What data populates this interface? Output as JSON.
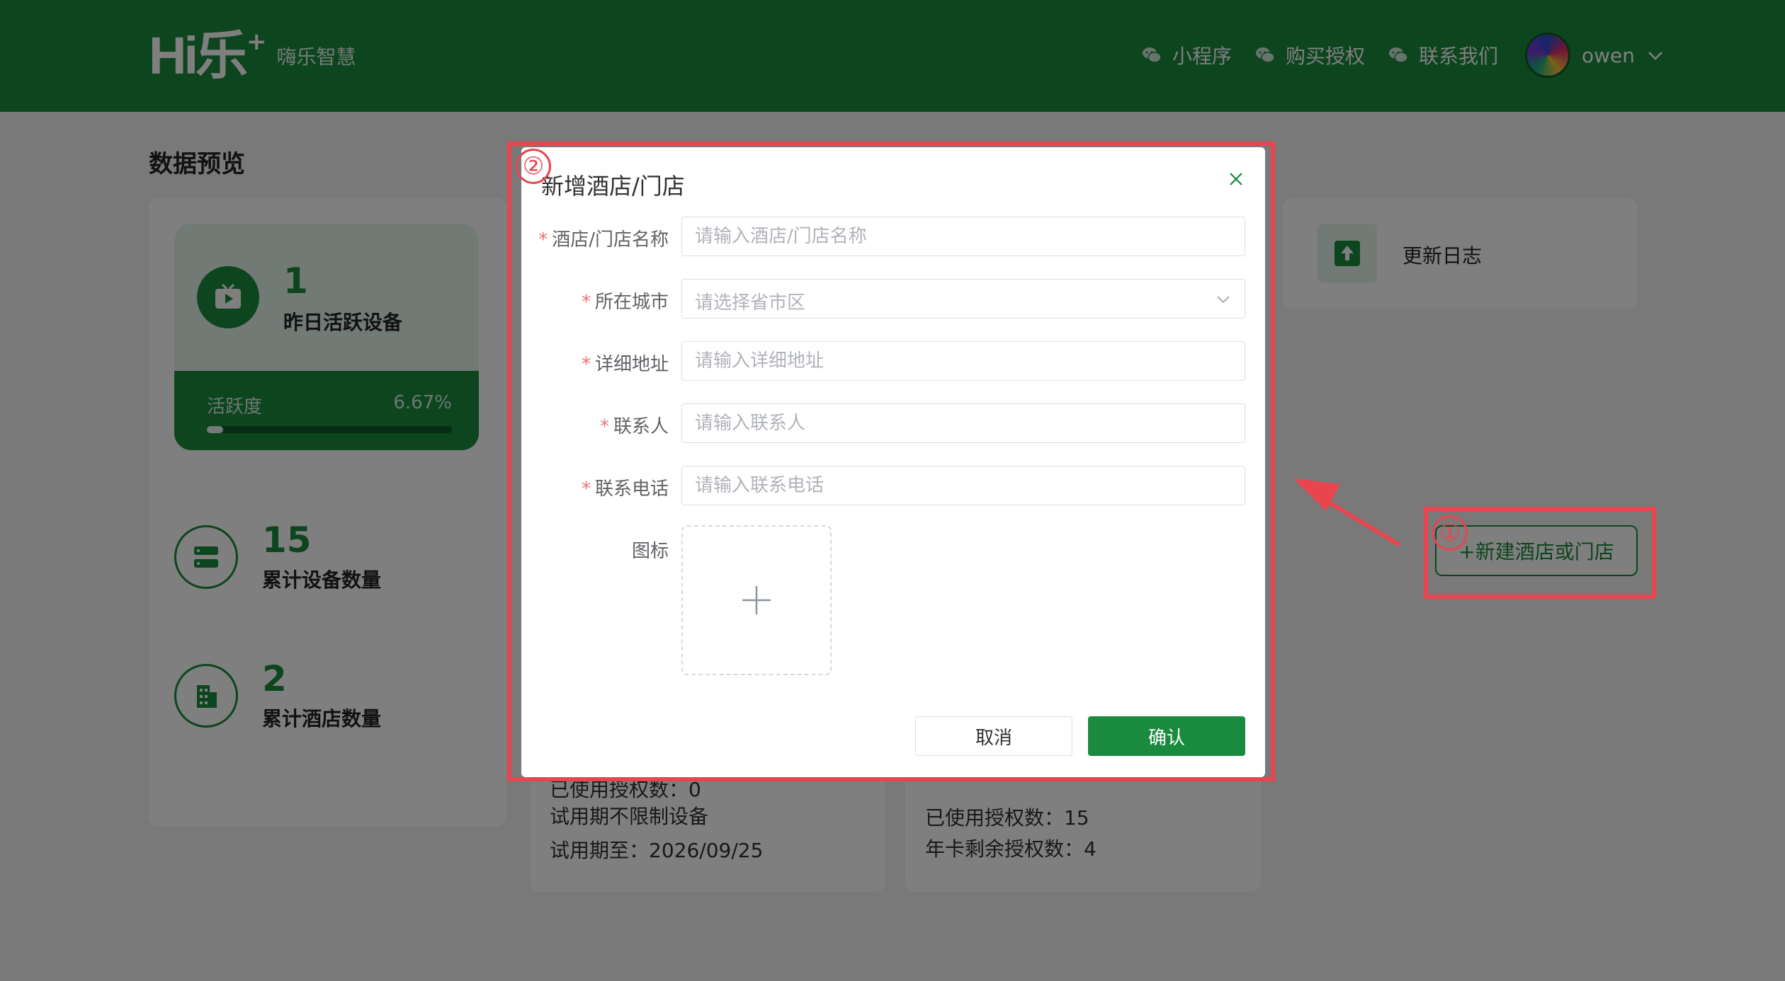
{
  "header": {
    "logo_mark": "Hi乐",
    "logo_plus": "+",
    "brand_name": "嗨乐智慧",
    "nav": [
      {
        "label": "小程序",
        "icon": "wechat-icon"
      },
      {
        "label": "购买授权",
        "icon": "wechat-icon"
      },
      {
        "label": "联系我们",
        "icon": "wechat-icon"
      }
    ],
    "user": {
      "name": "owen"
    }
  },
  "page": {
    "section_title": "数据预览",
    "active_devices": {
      "value": "1",
      "label": "昨日活跃设备",
      "activity_label": "活跃度",
      "activity_value": "6.67%",
      "activity_fraction": 0.0667
    },
    "total_devices": {
      "value": "15",
      "label": "累计设备数量"
    },
    "total_hotels": {
      "value": "2",
      "label": "累计酒店数量"
    },
    "license_card_a": {
      "used": "已使用授权数：0",
      "trial_note": "试用期不限制设备",
      "trial_until": "试用期至：2026/09/25"
    },
    "license_card_b": {
      "used": "已使用授权数：15",
      "remaining": "年卡剩余授权数：4"
    },
    "update_log": "更新日志",
    "new_hotel_button": "+新建酒店或门店"
  },
  "dialog": {
    "title": "新增酒店/门店",
    "fields": {
      "name": {
        "label": "酒店/门店名称",
        "placeholder": "请输入酒店/门店名称",
        "required": true
      },
      "city": {
        "label": "所在城市",
        "placeholder": "请选择省市区",
        "required": true
      },
      "address": {
        "label": "详细地址",
        "placeholder": "请输入详细地址",
        "required": true
      },
      "contact": {
        "label": "联系人",
        "placeholder": "请输入联系人",
        "required": true
      },
      "phone": {
        "label": "联系电话",
        "placeholder": "请输入联系电话",
        "required": true
      },
      "icon": {
        "label": "图标",
        "required": false
      }
    },
    "required_mark": "*",
    "cancel": "取消",
    "confirm": "确认"
  },
  "annotations": {
    "step1": "①",
    "step2": "②",
    "color": "#e8454f"
  },
  "colors": {
    "brand": "#1a8a3e",
    "danger": "#f56c6c"
  }
}
